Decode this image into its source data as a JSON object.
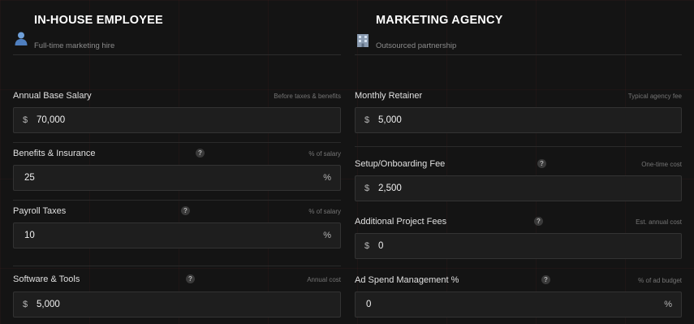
{
  "inhouse": {
    "title": "IN-HOUSE EMPLOYEE",
    "subtitle": "Full-time marketing hire",
    "icon": "person-icon",
    "fields": [
      {
        "label": "Annual Base Salary",
        "hint": "Before taxes & benefits",
        "prefix": "$",
        "value": "70,000",
        "suffix": ""
      },
      {
        "label": "Benefits & Insurance",
        "hint": "% of salary",
        "help": "?",
        "prefix": "",
        "value": "25",
        "suffix": "%"
      },
      {
        "label": "Payroll Taxes",
        "hint": "% of salary",
        "help": "?",
        "prefix": "",
        "value": "10",
        "suffix": "%"
      },
      {
        "label": "Software & Tools",
        "hint": "Annual cost",
        "help": "?",
        "prefix": "$",
        "value": "5,000",
        "suffix": ""
      }
    ]
  },
  "agency": {
    "title": "MARKETING AGENCY",
    "subtitle": "Outsourced partnership",
    "icon": "building-icon",
    "fields": [
      {
        "label": "Monthly Retainer",
        "hint": "Typical agency fee",
        "prefix": "$",
        "value": "5,000",
        "suffix": ""
      },
      {
        "label": "Setup/Onboarding Fee",
        "hint": "One-time cost",
        "help": "?",
        "prefix": "$",
        "value": "2,500",
        "suffix": ""
      },
      {
        "label": "Additional Project Fees",
        "hint": "Est. annual cost",
        "help": "?",
        "prefix": "$",
        "value": "0",
        "suffix": ""
      },
      {
        "label": "Ad Spend Management %",
        "hint": "% of ad budget",
        "help": "?",
        "prefix": "",
        "value": "0",
        "suffix": "%"
      }
    ]
  },
  "colors": {
    "background": "#141414",
    "input_bg": "#1e1e1e",
    "border": "#333333",
    "text": "#e6e6e6",
    "muted": "#757575"
  }
}
